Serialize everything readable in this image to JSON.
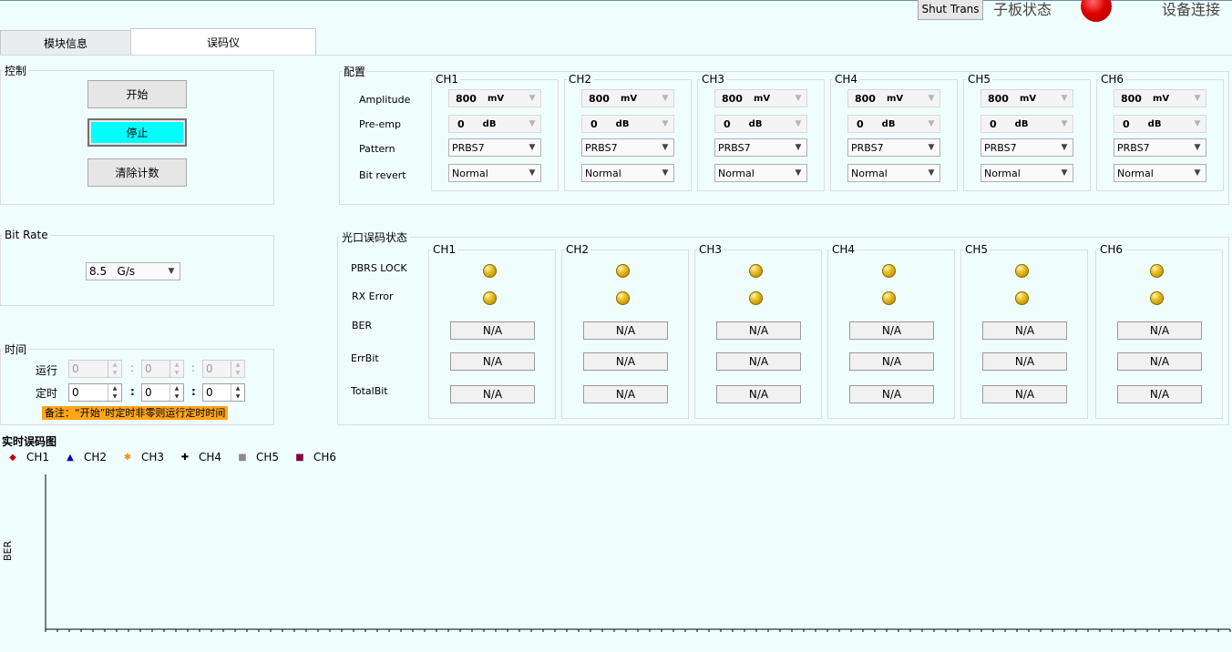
{
  "header": {
    "shut_trans_label": "Shut Trans",
    "board_status_label": "子板状态",
    "device_connect_label": "设备连接",
    "status_color": "#d40000"
  },
  "tabs": [
    {
      "label": "模块信息",
      "active": false
    },
    {
      "label": "误码仪",
      "active": true
    }
  ],
  "control": {
    "title": "控制",
    "start_label": "开始",
    "stop_label": "停止",
    "clear_label": "清除计数",
    "stop_color": "#00ffff"
  },
  "bitrate": {
    "title": "Bit Rate",
    "value": "8.5   G/s"
  },
  "time": {
    "title": "时间",
    "run_label": "运行",
    "timer_label": "定时",
    "run_values": [
      "0",
      "0",
      "0"
    ],
    "timer_values": [
      "0",
      "0",
      "0"
    ],
    "separator": ":",
    "note": "备注：“开始”时定时非零则运行定时时间"
  },
  "config": {
    "title": "配置",
    "row_labels": [
      "Amplitude",
      "Pre-emp",
      "Pattern",
      "Bit revert"
    ],
    "channels": [
      {
        "name": "CH1",
        "amp_num": "800",
        "amp_unit": "mV",
        "pre_num": "0",
        "pre_unit": "dB",
        "pattern": "PRBS7",
        "revert": "Normal"
      },
      {
        "name": "CH2",
        "amp_num": "800",
        "amp_unit": "mV",
        "pre_num": "0",
        "pre_unit": "dB",
        "pattern": "PRBS7",
        "revert": "Normal"
      },
      {
        "name": "CH3",
        "amp_num": "800",
        "amp_unit": "mV",
        "pre_num": "0",
        "pre_unit": "dB",
        "pattern": "PRBS7",
        "revert": "Normal"
      },
      {
        "name": "CH4",
        "amp_num": "800",
        "amp_unit": "mV",
        "pre_num": "0",
        "pre_unit": "dB",
        "pattern": "PRBS7",
        "revert": "Normal"
      },
      {
        "name": "CH5",
        "amp_num": "800",
        "amp_unit": "mV",
        "pre_num": "0",
        "pre_unit": "dB",
        "pattern": "PRBS7",
        "revert": "Normal"
      },
      {
        "name": "CH6",
        "amp_num": "800",
        "amp_unit": "mV",
        "pre_num": "0",
        "pre_unit": "dB",
        "pattern": "PRBS7",
        "revert": "Normal"
      }
    ]
  },
  "optical": {
    "title": "光口误码状态",
    "row_labels": [
      "PBRS LOCK",
      "RX Error",
      "BER",
      "ErrBit",
      "TotalBit"
    ],
    "led_color": "#e8c02a",
    "channels": [
      {
        "name": "CH1",
        "ber": "N/A",
        "errbit": "N/A",
        "totalbit": "N/A"
      },
      {
        "name": "CH2",
        "ber": "N/A",
        "errbit": "N/A",
        "totalbit": "N/A"
      },
      {
        "name": "CH3",
        "ber": "N/A",
        "errbit": "N/A",
        "totalbit": "N/A"
      },
      {
        "name": "CH4",
        "ber": "N/A",
        "errbit": "N/A",
        "totalbit": "N/A"
      },
      {
        "name": "CH5",
        "ber": "N/A",
        "errbit": "N/A",
        "totalbit": "N/A"
      },
      {
        "name": "CH6",
        "ber": "N/A",
        "errbit": "N/A",
        "totalbit": "N/A"
      }
    ]
  },
  "chart": {
    "title": "实时误码图",
    "ylabel": "BER",
    "legend": [
      {
        "name": "CH1",
        "marker": "◆",
        "color": "#c00000"
      },
      {
        "name": "CH2",
        "marker": "▲",
        "color": "#0000cc"
      },
      {
        "name": "CH3",
        "marker": "✱",
        "color": "#ff8c00"
      },
      {
        "name": "CH4",
        "marker": "✚",
        "color": "#000000"
      },
      {
        "name": "CH5",
        "marker": "■",
        "color": "#8c8c8c"
      },
      {
        "name": "CH6",
        "marker": "■",
        "color": "#800040"
      }
    ]
  },
  "chart_data": {
    "type": "scatter",
    "title": "实时误码图",
    "xlabel": "",
    "ylabel": "BER",
    "series": [
      {
        "name": "CH1",
        "values": []
      },
      {
        "name": "CH2",
        "values": []
      },
      {
        "name": "CH3",
        "values": []
      },
      {
        "name": "CH4",
        "values": []
      },
      {
        "name": "CH5",
        "values": []
      },
      {
        "name": "CH6",
        "values": []
      }
    ],
    "grid": false,
    "legend": "top-left"
  }
}
